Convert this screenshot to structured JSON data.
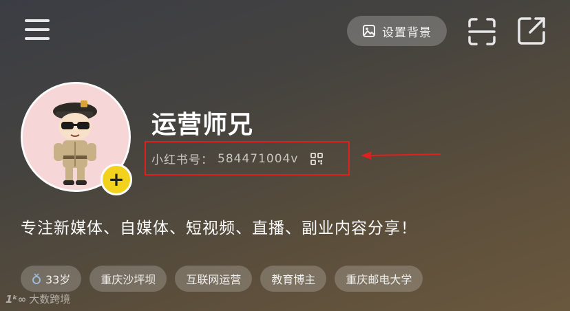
{
  "header": {
    "menu_icon": "hamburger-menu-icon",
    "set_background_label": "设置背景",
    "set_background_icon": "image-icon",
    "scan_icon": "scan-icon",
    "share_icon": "share-icon"
  },
  "profile": {
    "name": "运营师兄",
    "id_prefix": "小红书号：",
    "id_value": "584471004v",
    "qr_icon": "qr-code-icon",
    "add_icon": "plus-icon",
    "bio": "专注新媒体、自媒体、短视频、直播、副业内容分享！"
  },
  "tags": [
    {
      "icon": "ring-icon",
      "label": "33岁"
    },
    {
      "label": "重庆沙坪坝"
    },
    {
      "label": "互联网运营"
    },
    {
      "label": "教育博主"
    },
    {
      "label": "重庆邮电大学"
    }
  ],
  "annotation": {
    "box_color": "#e01f1f",
    "arrow_color": "#e01f1f"
  },
  "watermark": {
    "logo": "1ᵏ∞",
    "text": "大数跨境"
  }
}
